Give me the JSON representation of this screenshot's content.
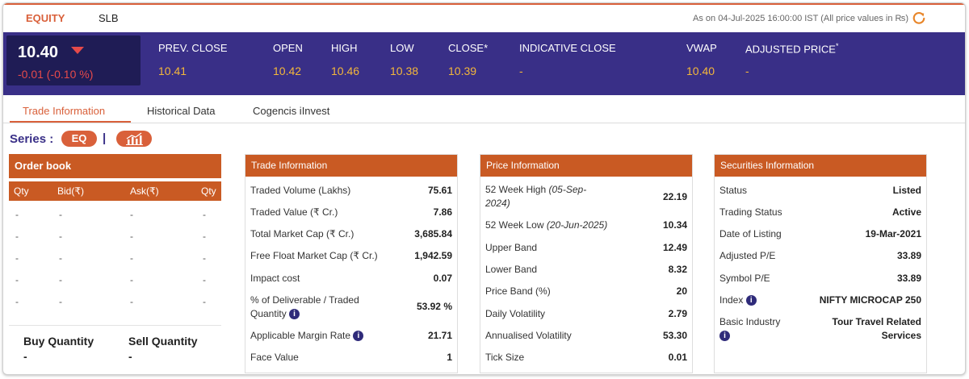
{
  "top_tabs": {
    "equity": "EQUITY",
    "slb": "SLB"
  },
  "as_on": "As on 04-Jul-2025 16:00:00 IST (All price values in ₨)",
  "price": {
    "ltp": "10.40",
    "change": "-0.01 (-0.10 %)"
  },
  "quote": [
    {
      "label": "PREV. CLOSE",
      "value": "10.41"
    },
    {
      "label": "OPEN",
      "value": "10.42"
    },
    {
      "label": "HIGH",
      "value": "10.46"
    },
    {
      "label": "LOW",
      "value": "10.38"
    },
    {
      "label": "CLOSE*",
      "value": "10.39"
    },
    {
      "label": "INDICATIVE CLOSE",
      "value": "-"
    },
    {
      "label": "VWAP",
      "value": "10.40"
    },
    {
      "label": "ADJUSTED PRICE",
      "value": "-"
    }
  ],
  "adjusted_star": "*",
  "sub_tabs": [
    "Trade Information",
    "Historical Data",
    "Cogencis iInvest"
  ],
  "series": {
    "label": "Series :",
    "value": "EQ",
    "sep": "|"
  },
  "order_book": {
    "title": "Order book",
    "columns": [
      "Qty",
      "Bid(₹)",
      "Ask(₹)",
      "Qty"
    ],
    "rows": [
      [
        "-",
        "-",
        "-",
        "-"
      ],
      [
        "-",
        "-",
        "-",
        "-"
      ],
      [
        "-",
        "-",
        "-",
        "-"
      ],
      [
        "-",
        "-",
        "-",
        "-"
      ],
      [
        "-",
        "-",
        "-",
        "-"
      ]
    ],
    "buy_label": "Buy Quantity",
    "sell_label": "Sell Quantity",
    "buy_value": "-",
    "sell_value": "-"
  },
  "trade_info": {
    "title": "Trade Information",
    "rows": [
      {
        "label": "Traded Volume (Lakhs)",
        "value": "75.61"
      },
      {
        "label": "Traded Value (₹ Cr.)",
        "value": "7.86"
      },
      {
        "label": "Total Market Cap (₹ Cr.)",
        "value": "3,685.84"
      },
      {
        "label": "Free Float Market Cap (₹ Cr.)",
        "value": "1,942.59"
      },
      {
        "label": "Impact cost",
        "value": "0.07"
      },
      {
        "label": "% of Deliverable / Traded",
        "label2": "Quantity",
        "value": "53.92 %"
      },
      {
        "label": "Applicable Margin Rate",
        "value": "21.71"
      },
      {
        "label": "Face Value",
        "value": "1"
      }
    ]
  },
  "price_info": {
    "title": "Price Information",
    "rows": [
      {
        "label": "52 Week High",
        "sub": "(05-Sep-",
        "sub2": "2024)",
        "value": "22.19"
      },
      {
        "label": "52 Week Low",
        "sub": "(20-Jun-2025)",
        "value": "10.34"
      },
      {
        "label": "Upper Band",
        "value": "12.49"
      },
      {
        "label": "Lower Band",
        "value": "8.32"
      },
      {
        "label": "Price Band (%)",
        "value": "20"
      },
      {
        "label": "Daily Volatility",
        "value": "2.79"
      },
      {
        "label": "Annualised Volatility",
        "value": "53.30"
      },
      {
        "label": "Tick Size",
        "value": "0.01"
      }
    ]
  },
  "securities_info": {
    "title": "Securities Information",
    "rows": [
      {
        "label": "Status",
        "value": "Listed"
      },
      {
        "label": "Trading Status",
        "value": "Active"
      },
      {
        "label": "Date of Listing",
        "value": "19-Mar-2021"
      },
      {
        "label": "Adjusted P/E",
        "value": "33.89"
      },
      {
        "label": "Symbol P/E",
        "value": "33.89"
      },
      {
        "label": "Index",
        "value": "NIFTY MICROCAP 250"
      },
      {
        "label": "Basic Industry",
        "value": "Tour Travel Related",
        "value2": "Services"
      }
    ]
  },
  "info_icon_glyph": "i",
  "colors": {
    "accent": "#d9603a",
    "band": "#392f87",
    "negative": "#e64a4a",
    "quote_value": "#f4b73a"
  }
}
